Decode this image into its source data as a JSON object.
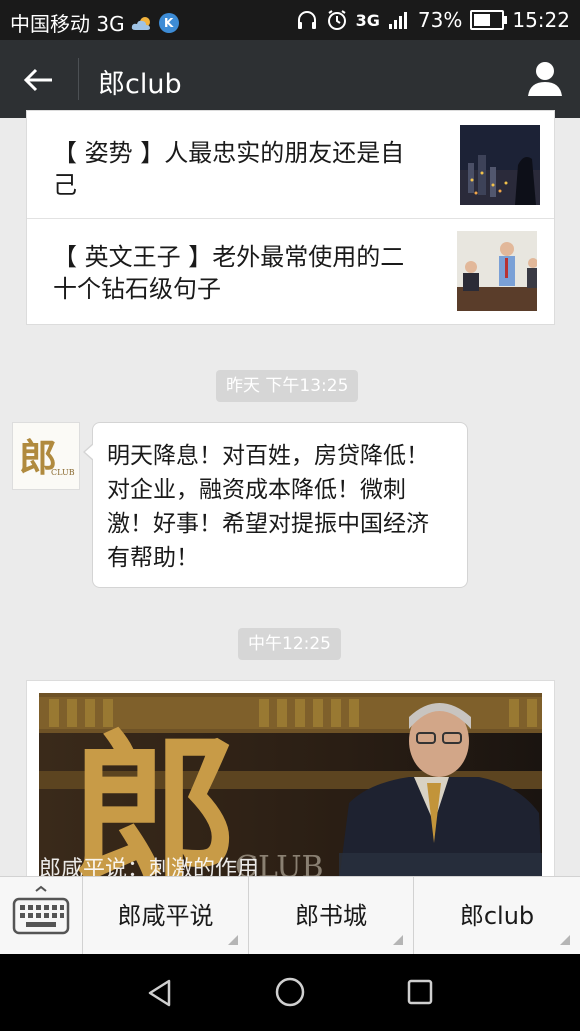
{
  "status_bar": {
    "carrier": "中国移动 3G",
    "k_badge": "K",
    "network_label": "3G",
    "battery_percent": "73%",
    "battery_level": 0.73,
    "time": "15:22"
  },
  "header": {
    "title": "郎club"
  },
  "articles": [
    {
      "title": "【 姿势 】人最忠实的朋友还是自己"
    },
    {
      "title": "【 英文王子 】老外最常使用的二十个钻石级句子"
    }
  ],
  "timestamps": {
    "first": "昨天 下午13:25",
    "second": "中午12:25"
  },
  "avatar": {
    "text": "郎",
    "subtext": "CLUB"
  },
  "message": {
    "text": "明天降息！对百姓，房贷降低！对企业，融资成本降低！微刺激！好事！希望对提振中国经济有帮助！"
  },
  "feature_image": {
    "overlay_glyph": "郎",
    "overlay_word": "CLUB",
    "caption": "郎咸平说：刺激的作用"
  },
  "menu": {
    "items": [
      "郎咸平说",
      "郎书城",
      "郎club"
    ]
  },
  "colors": {
    "title_bar": "#2d3033",
    "status_bar": "#1a1a1a",
    "background": "#ebebeb",
    "timestamp_bg": "#d6d6d6"
  },
  "icons": {
    "back": "arrow-left-icon",
    "profile": "person-icon",
    "keyboard": "keyboard-icon",
    "nav_back": "triangle-back-icon",
    "nav_home": "circle-home-icon",
    "nav_recent": "square-recent-icon"
  }
}
